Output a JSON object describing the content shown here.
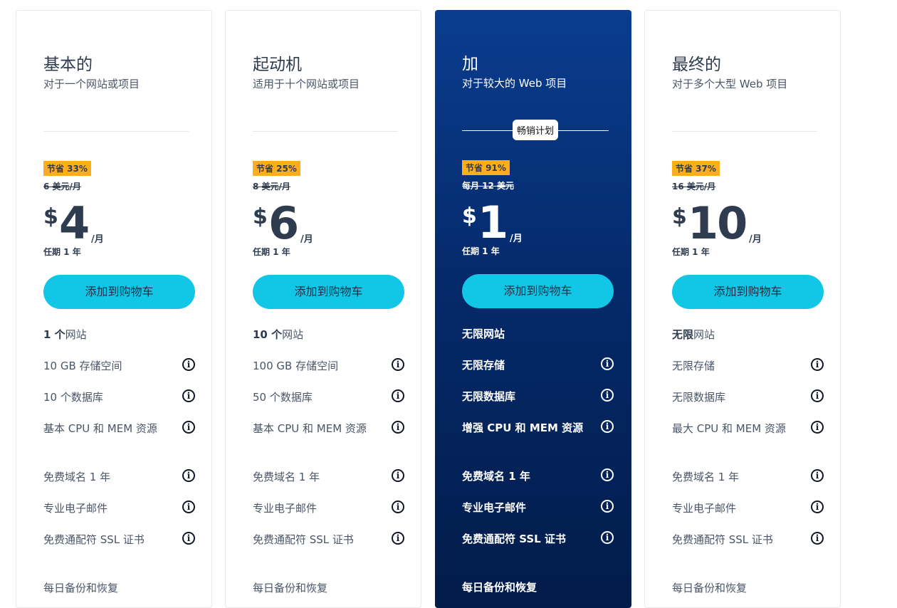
{
  "plans": [
    {
      "title": "基本的",
      "subtitle": "对于一个网站或项目",
      "badge": "节省 33%",
      "old_price": "6 美元/月",
      "currency": "$",
      "amount": "4",
      "per": "/月",
      "term": "任期 1 年",
      "cta": "添加到购物车",
      "features": [
        {
          "bold": "1 个",
          "text": "网站"
        },
        {
          "bold": "",
          "text": "10 GB 存储空间",
          "info": "i"
        },
        {
          "bold": "",
          "text": "10 个数据库",
          "info": "i"
        },
        {
          "bold": "",
          "text": "基本 CPU 和 MEM 资源",
          "info": "i"
        },
        {
          "bold": "",
          "text": "免费域名 1 年",
          "info": "i"
        },
        {
          "bold": "",
          "text": "专业电子邮件",
          "info": "i"
        },
        {
          "bold": "",
          "text": "免费通配符 SSL 证书",
          "info": "i"
        },
        {
          "bold": "",
          "text": "每日备份和恢复"
        }
      ]
    },
    {
      "title": "起动机",
      "subtitle": "适用于十个网站或项目",
      "badge": "节省 25%",
      "old_price": "8 美元/月",
      "currency": "$",
      "amount": "6",
      "per": "/月",
      "term": "任期 1 年",
      "cta": "添加到购物车",
      "features": [
        {
          "bold": "10 个",
          "text": "网站"
        },
        {
          "bold": "",
          "text": "100 GB 存储空间",
          "info": "i"
        },
        {
          "bold": "",
          "text": "50 个数据库",
          "info": "i"
        },
        {
          "bold": "",
          "text": "基本 CPU 和 MEM 资源",
          "info": "i"
        },
        {
          "bold": "",
          "text": "免费域名 1 年",
          "info": "i"
        },
        {
          "bold": "",
          "text": "专业电子邮件",
          "info": "i"
        },
        {
          "bold": "",
          "text": "免费通配符 SSL 证书",
          "info": "i"
        },
        {
          "bold": "",
          "text": "每日备份和恢复"
        }
      ]
    },
    {
      "title": "加",
      "subtitle": "对于较大的 Web 项目",
      "bestseller": "畅销计划",
      "badge": "节省 91%",
      "old_price": "每月 12 美元",
      "currency": "$",
      "amount": "1",
      "per": "/月",
      "term": "任期 1 年",
      "cta": "添加到购物车",
      "features": [
        {
          "bold": "",
          "text": "无限网站"
        },
        {
          "bold": "",
          "text": "无限存储",
          "info": "i"
        },
        {
          "bold": "",
          "text": "无限数据库",
          "info": "i"
        },
        {
          "bold": "",
          "text": "增强 CPU 和 MEM 资源",
          "info": "i"
        },
        {
          "bold": "",
          "text": "免费域名 1 年",
          "info": "i"
        },
        {
          "bold": "",
          "text": "专业电子邮件",
          "info": "i"
        },
        {
          "bold": "",
          "text": "免费通配符 SSL 证书",
          "info": "i"
        },
        {
          "bold": "",
          "text": "每日备份和恢复"
        }
      ]
    },
    {
      "title": "最终的",
      "subtitle": "对于多个大型 Web 项目",
      "badge": "节省 37%",
      "old_price": "16 美元/月",
      "currency": "$",
      "amount": "10",
      "per": "/月",
      "term": "任期 1 年",
      "cta": "添加到购物车",
      "features": [
        {
          "bold": "无限",
          "text": "网站"
        },
        {
          "bold": "",
          "text": "无限存储",
          "info": "i"
        },
        {
          "bold": "",
          "text": "无限数据库",
          "info": "i"
        },
        {
          "bold": "",
          "text": "最大 CPU 和 MEM 资源",
          "info": "i"
        },
        {
          "bold": "",
          "text": "免费域名 1 年",
          "info": "i"
        },
        {
          "bold": "",
          "text": "专业电子邮件",
          "info": "i"
        },
        {
          "bold": "",
          "text": "免费通配符 SSL 证书",
          "info": "i"
        },
        {
          "bold": "",
          "text": "每日备份和恢复"
        }
      ]
    }
  ],
  "colors": {
    "accent_button": "#12c7e6",
    "badge": "#ffad1d",
    "featured_top": "#0a3d8f",
    "featured_bottom": "#021c4a",
    "text_dark": "#2f3b4f"
  },
  "icons": {
    "info": "info-circle-icon"
  }
}
